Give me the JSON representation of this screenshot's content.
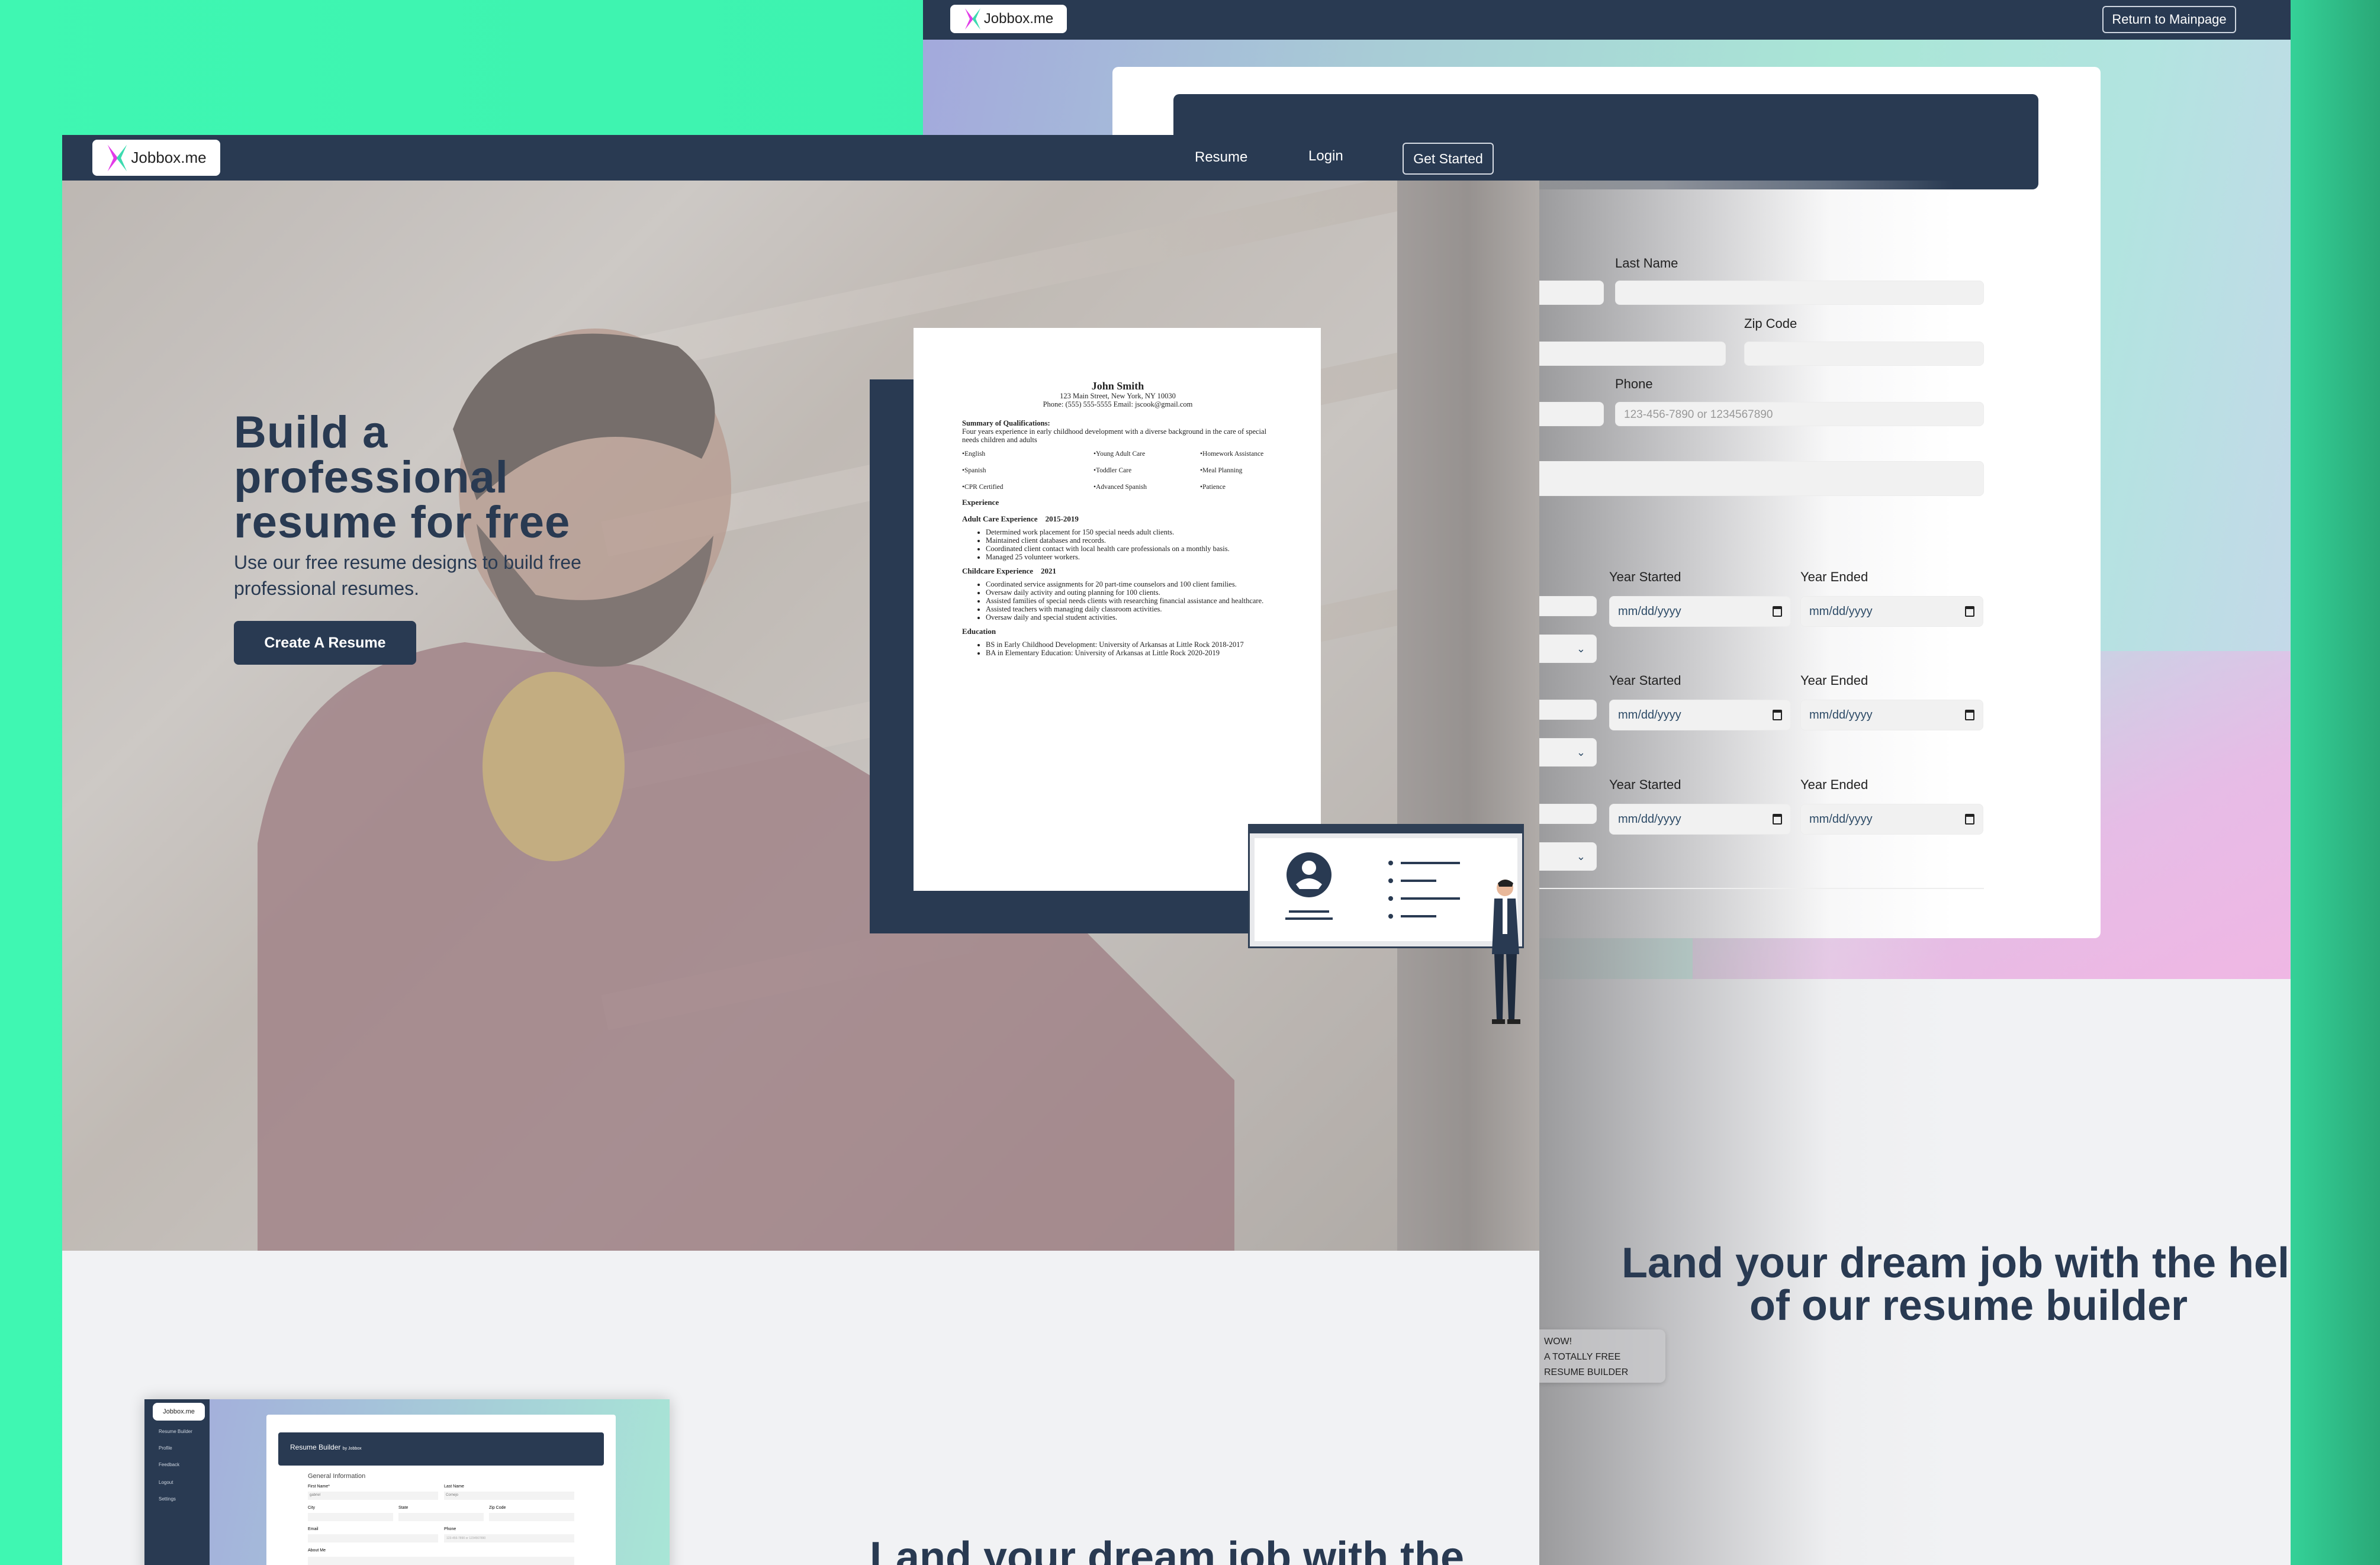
{
  "back_window": {
    "logo_text": "Jobbox.me",
    "return_button": "Return to Mainpage",
    "form": {
      "last_name_label": "Last Name",
      "zip_label": "Zip Code",
      "phone_label": "Phone",
      "phone_placeholder": "123-456-7890 or 1234567890",
      "experience_rows": [
        {
          "start_label": "Year Started",
          "end_label": "Year Ended",
          "start_placeholder": "mm/dd/yyyy",
          "end_placeholder": "mm/dd/yyyy"
        },
        {
          "start_label": "Year Started",
          "end_label": "Year Ended",
          "start_placeholder": "mm/dd/yyyy",
          "end_placeholder": "mm/dd/yyyy"
        },
        {
          "start_label": "Year Started",
          "end_label": "Year Ended",
          "start_placeholder": "mm/dd/yyyy",
          "end_placeholder": "mm/dd/yyyy"
        }
      ]
    },
    "headline": "Land your dream job with the help of our resume builder",
    "badge": [
      "WOW!",
      "A TOTALLY FREE",
      "RESUME BUILDER"
    ]
  },
  "front_window": {
    "logo_text": "Jobbox.me",
    "nav": {
      "resume": "Resume",
      "login": "Login",
      "get_started": "Get Started"
    },
    "hero": {
      "title": "Build a professional resume for free",
      "subtitle": "Use our free resume designs to build free professional resumes.",
      "cta": "Create A Resume"
    },
    "resume_sample": {
      "name": "John Smith",
      "address": "123 Main Street, New York, NY 10030",
      "contact": "Phone: (555) 555-5555 Email: jscook@gmail.com",
      "summary_heading": "Summary of Qualifications:",
      "summary": "Four years experience in early childhood development with a diverse background in the care of special needs children and adults",
      "skills": [
        "•English",
        "•Young Adult Care",
        "•Homework Assistance",
        "•Spanish",
        "•Toddler Care",
        "•Meal Planning",
        "•CPR Certified",
        "•Advanced Spanish",
        "•Patience"
      ],
      "experience_heading": "Experience",
      "jobs": [
        {
          "title": "Adult Care Experience    2015-2019",
          "bullets": [
            "Determined work placement for 150 special needs adult clients.",
            "Maintained client databases and records.",
            "Coordinated client contact with local health care professionals on a monthly basis.",
            "Managed 25 volunteer workers."
          ]
        },
        {
          "title": "Childcare Experience    2021",
          "bullets": [
            "Coordinated service assignments for 20 part-time counselors and 100 client families.",
            "Oversaw daily activity and outing planning for 100 clients.",
            "Assisted families of special needs clients with researching financial assistance and healthcare.",
            "Assisted teachers with managing daily classroom activities.",
            "Oversaw daily and special student activities."
          ]
        }
      ],
      "education_heading": "Education",
      "education": [
        "BS in Early Childhood Development: University of Arkansas at Little Rock 2018-2017",
        "BA in Elementary Education: University of Arkansas at Little Rock 2020-2019"
      ]
    },
    "mini_preview": {
      "logo_text": "Jobbox.me",
      "sidebar": [
        "Resume Builder",
        "Profile",
        "Feedback",
        "Logout",
        "Settings"
      ],
      "header": "Resume Builder",
      "header_sub": "by Jobbox",
      "section": "General Information",
      "first_name_label": "First Name*",
      "first_name_value": "gabriel",
      "last_name_label": "Last Name",
      "last_name_value": "Cornejo",
      "city_label": "City",
      "state_label": "State",
      "zip_label": "Zip Code",
      "email_label": "Email",
      "phone_label": "Phone",
      "phone_placeholder": "123-456-7890 or 1234567890",
      "about_label": "About Me"
    },
    "section_headline": "Land your dream job with the"
  },
  "colors": {
    "navy": "#293a52",
    "green": "#3ff7b2",
    "light": "#f1f2f4"
  }
}
